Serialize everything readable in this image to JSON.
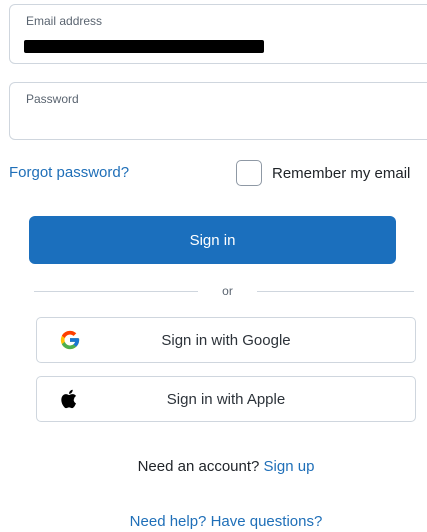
{
  "email_field": {
    "label": "Email address",
    "value": ""
  },
  "password_field": {
    "label": "Password",
    "value": ""
  },
  "forgot_password": "Forgot password?",
  "remember": {
    "label": "Remember my email",
    "checked": false
  },
  "sign_in": "Sign in",
  "divider": "or",
  "google": {
    "label": "Sign in with Google",
    "icon": "google-icon"
  },
  "apple": {
    "label": "Sign in with Apple",
    "icon": "apple-icon"
  },
  "signup": {
    "prompt": "Need an account?",
    "link": "Sign up"
  },
  "help": "Need help? Have questions?",
  "colors": {
    "primary": "#1b6fbd",
    "link": "#1f6fb8",
    "border": "#cfd6de"
  }
}
